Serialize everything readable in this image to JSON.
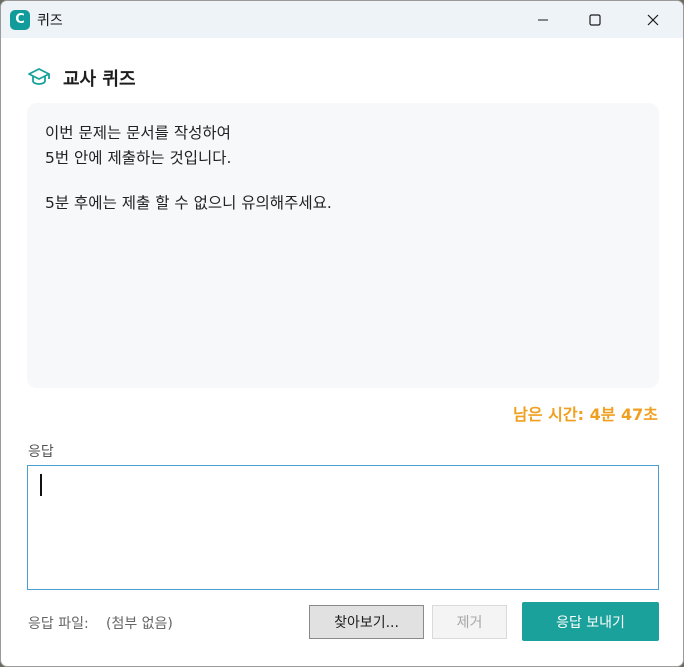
{
  "window": {
    "title": "퀴즈",
    "app_icon_letter": "C",
    "controls": [
      "minimize-icon",
      "maximize-icon",
      "close-icon"
    ]
  },
  "header": {
    "title": "교사 퀴즈",
    "icon": "graduation-cap-icon"
  },
  "message": {
    "lines": [
      "이번 문제는 문서를 작성하여",
      "5번 안에 제출하는 것입니다.",
      "",
      "5분 후에는 제출 할 수 없으니 유의해주세요."
    ]
  },
  "timer": {
    "text": "남은 시간: 4분 47초"
  },
  "answer": {
    "label": "응답",
    "value": ""
  },
  "attachment": {
    "label": "응답 파일:",
    "status": "(첨부 없음)"
  },
  "buttons": {
    "browse": "찾아보기...",
    "remove": "제거",
    "send": "응답 보내기"
  },
  "colors": {
    "accent": "#1aa19b",
    "timer": "#f0a020",
    "input_border": "#4a9fd0"
  }
}
